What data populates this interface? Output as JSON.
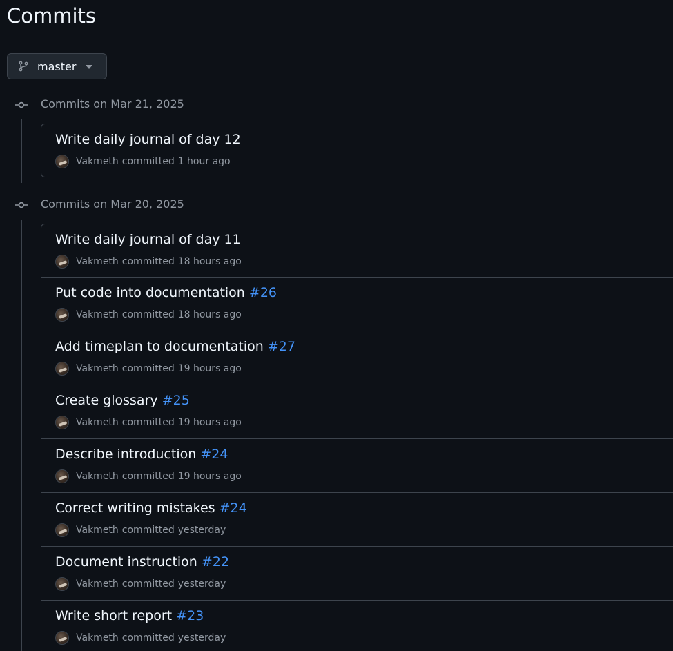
{
  "page": {
    "title": "Commits"
  },
  "branch": {
    "name": "master",
    "icon": "git-branch-icon"
  },
  "groups": [
    {
      "label": "Commits on Mar 21, 2025",
      "commits": [
        {
          "message": "Write daily journal of day 12",
          "pr": "",
          "author": "Vakmeth",
          "verb": "committed",
          "time": "1 hour ago"
        }
      ]
    },
    {
      "label": "Commits on Mar 20, 2025",
      "commits": [
        {
          "message": "Write daily journal of day 11",
          "pr": "",
          "author": "Vakmeth",
          "verb": "committed",
          "time": "18 hours ago"
        },
        {
          "message": "Put code into documentation",
          "pr": "#26",
          "author": "Vakmeth",
          "verb": "committed",
          "time": "18 hours ago"
        },
        {
          "message": "Add timeplan to documentation",
          "pr": "#27",
          "author": "Vakmeth",
          "verb": "committed",
          "time": "19 hours ago"
        },
        {
          "message": "Create glossary",
          "pr": "#25",
          "author": "Vakmeth",
          "verb": "committed",
          "time": "19 hours ago"
        },
        {
          "message": "Describe introduction",
          "pr": "#24",
          "author": "Vakmeth",
          "verb": "committed",
          "time": "19 hours ago"
        },
        {
          "message": "Correct writing mistakes",
          "pr": "#24",
          "author": "Vakmeth",
          "verb": "committed",
          "time": "yesterday"
        },
        {
          "message": "Document instruction",
          "pr": "#22",
          "author": "Vakmeth",
          "verb": "committed",
          "time": "yesterday"
        },
        {
          "message": "Write short report",
          "pr": "#23",
          "author": "Vakmeth",
          "verb": "committed",
          "time": "yesterday"
        }
      ]
    }
  ],
  "colors": {
    "background": "#0d1117",
    "border": "#3d444d",
    "link": "#4493f8",
    "muted": "#9198a1",
    "text": "#f0f6fc"
  }
}
